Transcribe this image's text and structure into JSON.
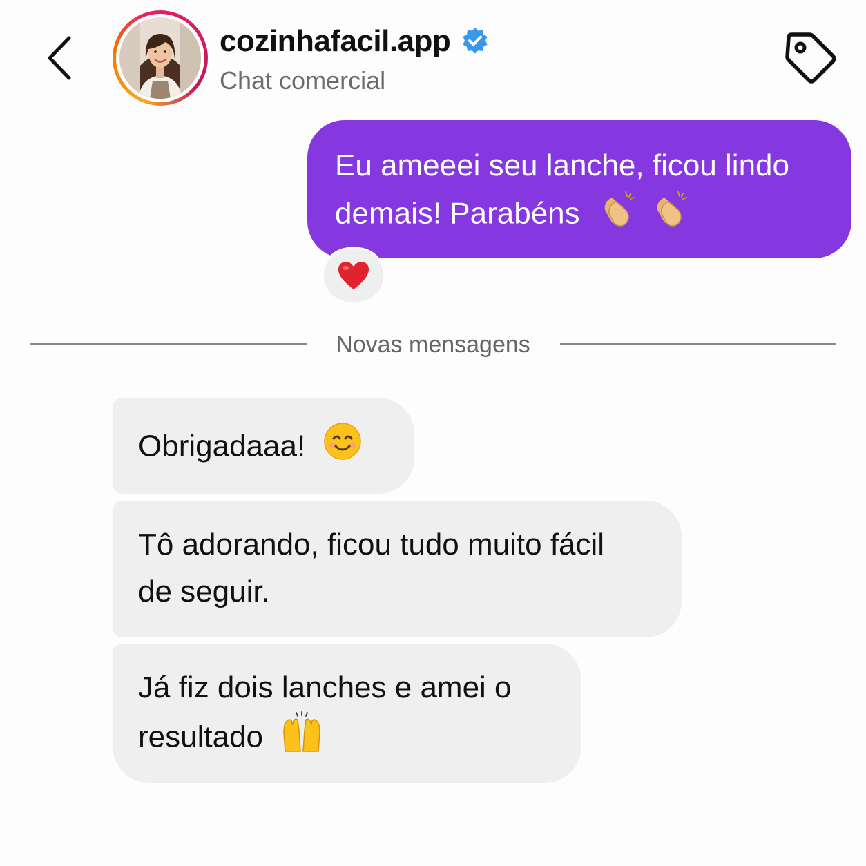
{
  "header": {
    "username": "cozinhafacil.app",
    "subtitle": "Chat comercial",
    "verified": true,
    "icons": [
      "back-chevron-icon",
      "verified-badge-icon",
      "tag-icon"
    ]
  },
  "messages": {
    "outgoing": {
      "line1": "Eu ameeei seu lanche, ficou lindo",
      "line2": "demais! Parabéns",
      "emojis": [
        "clapping-hands-emoji",
        "clapping-hands-emoji"
      ],
      "reaction": "red-heart-emoji"
    },
    "divider_label": "Novas mensagens",
    "incoming": [
      {
        "line1": "Obrigadaaa!",
        "emoji": "smiling-face-emoji"
      },
      {
        "line1": "Tô adorando, ficou tudo muito fácil",
        "line2": "de seguir."
      },
      {
        "line1": "Já fiz dois lanches e amei o",
        "line2": "resultado",
        "emoji": "raising-hands-emoji"
      }
    ]
  },
  "colors": {
    "outgoing_bubble": "#8638e0",
    "incoming_bubble": "#efefef",
    "verified_badge": "#3897f0",
    "background": "#fdfdfd"
  }
}
